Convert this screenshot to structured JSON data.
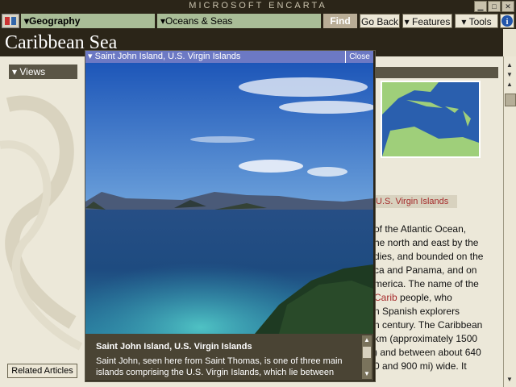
{
  "window": {
    "title": "MICROSOFT ENCARTA"
  },
  "toolbar": {
    "category": "Geography",
    "subcategory": "Oceans & Seas",
    "find": "Find",
    "go_back": "Go Back",
    "features": "Features",
    "tools": "Tools"
  },
  "article": {
    "title": "Caribbean Sea",
    "views_label": "Views",
    "map_caption": "U.S. Virgin Islands",
    "lines": [
      "of the Atlantic Ocean,",
      "he north and east by the",
      "dies, and bounded on the",
      "ca and Panama, and on",
      "merica. The name of the",
      "n Spanish explorers",
      "n century. The Caribbean",
      "km (approximately 1500",
      ") and between about 640",
      "0 and 900 mi) wide. It"
    ],
    "carib_link": "Carib",
    "carib_rest": " people, who",
    "related_articles": "Related Articles"
  },
  "popup": {
    "title": "Saint John Island, U.S. Virgin Islands",
    "close": "Close",
    "caption_title": "Saint John Island, U.S. Virgin Islands",
    "caption_text": "Saint John, seen here from Saint Thomas, is one of three main islands comprising the U.S. Virgin Islands, which lie between"
  },
  "icons": {
    "minimize": "minimize-icon",
    "maximize": "maximize-icon",
    "close": "close-icon",
    "help": "info-icon"
  },
  "colors": {
    "chrome": "#2b2518",
    "popup_title": "#6c79c4",
    "link": "#a52a2a",
    "dropdown_green": "#a9bd97"
  }
}
